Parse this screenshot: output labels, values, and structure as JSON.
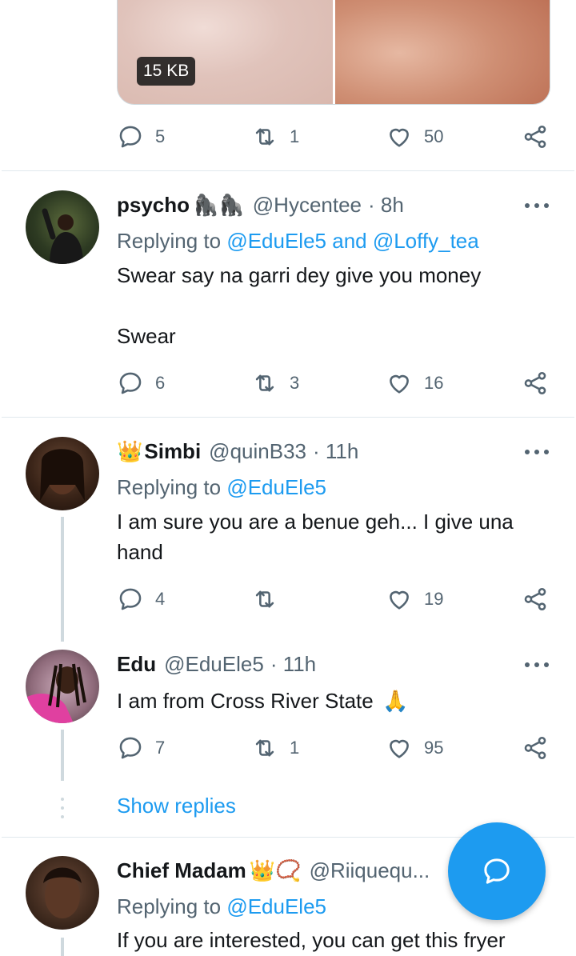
{
  "media": {
    "size_label": "15 KB"
  },
  "tweet0": {
    "replies": "5",
    "retweets": "1",
    "likes": "50"
  },
  "tweets": [
    {
      "name": "psycho",
      "emoji": "🦍🦍",
      "handle": "@Hycentee",
      "time": "· 8h",
      "replying_prefix": "Replying to",
      "replying_to": "@EduEle5 and @Loffy_tea",
      "text_line1": "Swear say na garri dey give you money",
      "text_line2": "Swear",
      "replies": "6",
      "retweets": "3",
      "likes": "16"
    },
    {
      "name": "Simbi",
      "emoji_prefix": "👑",
      "handle": "@quinB33",
      "time": "· 11h",
      "replying_prefix": "Replying to",
      "replying_to": "@EduEle5",
      "text": "I am sure you are a benue geh... I give una hand",
      "replies": "4",
      "retweets": "",
      "likes": "19"
    },
    {
      "name": "Edu",
      "handle": "@EduEle5",
      "time": "· 11h",
      "text": "I am from Cross River State",
      "emoji": "🙏",
      "replies": "7",
      "retweets": "1",
      "likes": "95"
    },
    {
      "name": "Chief Madam",
      "emoji": "👑📿",
      "handle": "@Riiquequ...",
      "replying_prefix": "Replying to",
      "replying_to": "@EduEle5",
      "text": "If you are interested, you can get this fryer"
    }
  ],
  "show_replies": "Show replies",
  "colors": {
    "accent": "#1d9bf0",
    "muted": "#536471",
    "text": "#14171a",
    "divider": "#e1e8ed"
  }
}
